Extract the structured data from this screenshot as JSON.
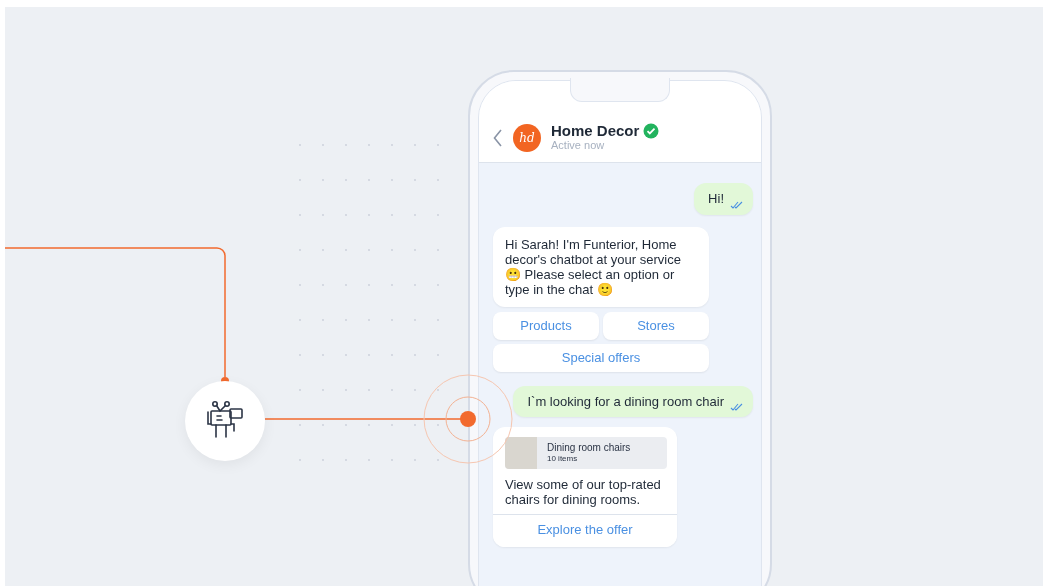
{
  "contact": {
    "avatar_text": "hd",
    "name": "Home Decor",
    "verified": true,
    "status": "Active now"
  },
  "messages": [
    {
      "kind": "outgoing",
      "text": "Hi!"
    },
    {
      "kind": "incoming",
      "text": "Hi Sarah! I'm Funterior, Home decor's chatbot at your service 😬 Please select an option or type in the chat 🙂"
    },
    {
      "kind": "options",
      "options": [
        "Products",
        "Stores",
        "Special offers"
      ]
    },
    {
      "kind": "outgoing",
      "text": "I`m looking for a dining room chair"
    },
    {
      "kind": "card",
      "card_title": "Dining room chairs",
      "card_subtitle": "10 items",
      "text": "View some of our top-rated chairs for dining rooms.",
      "action": "Explore the offer"
    }
  ]
}
